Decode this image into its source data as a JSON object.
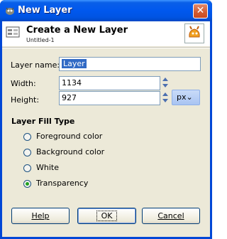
{
  "window": {
    "title": "New Layer",
    "close_glyph": "✕"
  },
  "header": {
    "title": "Create a New Layer",
    "subtitle": "Untitled-1",
    "icon": "layers-icon",
    "thumb_icon": "gimp-image-thumbnail"
  },
  "form": {
    "layer_name_label": "Layer name:",
    "layer_name_value": "Layer",
    "width_label": "Width:",
    "width_value": "1134",
    "height_label": "Height:",
    "height_value": "927",
    "unit": "px"
  },
  "fill": {
    "section_title": "Layer Fill Type",
    "options": [
      {
        "label": "Foreground color",
        "selected": false
      },
      {
        "label": "Background color",
        "selected": false
      },
      {
        "label": "White",
        "selected": false
      },
      {
        "label": "Transparency",
        "selected": true
      }
    ]
  },
  "buttons": {
    "help": "Help",
    "ok": "OK",
    "cancel": "Cancel"
  },
  "colors": {
    "titlebar": "#0054e3",
    "dialog_bg": "#ece9d8",
    "selection": "#316ac5",
    "radio_dot": "#21a121"
  }
}
